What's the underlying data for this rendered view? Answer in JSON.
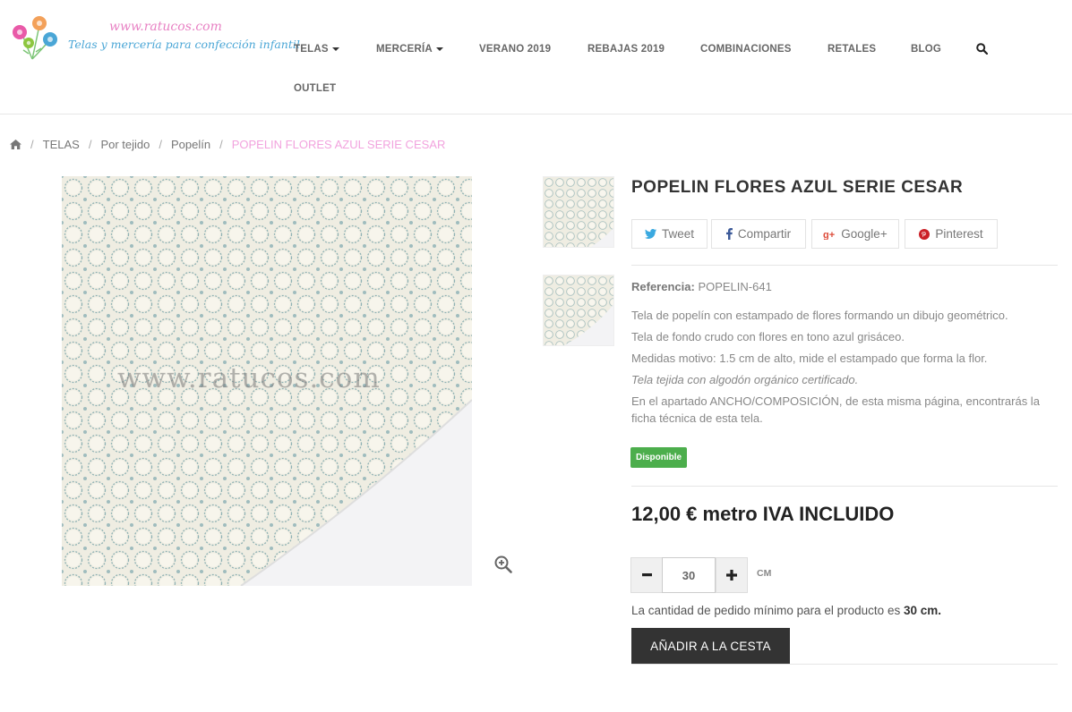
{
  "header": {
    "logo_url": "www.ratucos.com",
    "logo_tagline": "Telas y mercería para confección infantil",
    "nav": {
      "telas": "TELAS",
      "merceria": "MERCERÍA",
      "verano": "VERANO 2019",
      "rebajas": "REBAJAS 2019",
      "combinaciones": "COMBINACIONES",
      "retales": "RETALES",
      "blog": "BLOG",
      "outlet": "OUTLET"
    }
  },
  "breadcrumb": {
    "items": [
      "TELAS",
      "Por tejido",
      "Popelín"
    ],
    "current": "POPELIN FLORES AZUL SERIE CESAR"
  },
  "gallery": {
    "watermark": "www.ratucos.com"
  },
  "product": {
    "title": "POPELIN FLORES AZUL SERIE CESAR",
    "share": {
      "tweet": "Tweet",
      "share": "Compartir",
      "google": "Google+",
      "pinterest": "Pinterest"
    },
    "reference_label": "Referencia:",
    "reference": "POPELIN-641",
    "description": [
      "Tela de popelín con estampado de flores formando un dibujo geométrico.",
      "Tela de fondo crudo con flores en tono azul grisáceo.",
      "Medidas motivo: 1.5 cm de alto, mide el estampado que forma la flor.",
      "Tela tejida con algodón orgánico certificado.",
      "En el apartado ANCHO/COMPOSICIÓN, de esta misma página, encontrarás la ficha técnica de esta tela."
    ],
    "availability": "Disponible",
    "price": "12,00 € metro IVA INCLUIDO",
    "quantity": "30",
    "unit": "CM",
    "min_note_prefix": "La cantidad de pedido mínimo para el producto es",
    "min_note_value": "30 cm.",
    "add_to_cart": "AÑADIR A LA CESTA"
  },
  "colors": {
    "accent_pink": "#f2a3de",
    "available_green": "#4cae4c",
    "button_dark": "#333333"
  }
}
